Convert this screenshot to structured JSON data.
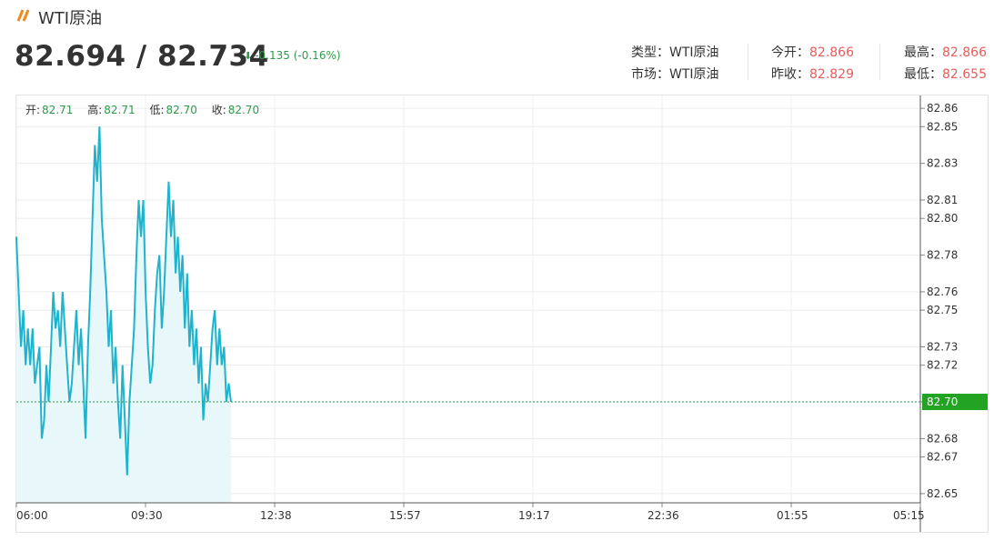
{
  "header": {
    "title": "WTI原油",
    "price": "82.694 / 82.734",
    "change": "-0.135 (-0.16%)"
  },
  "info": {
    "type_label": "类型：",
    "type_value": "WTI原油",
    "market_label": "市场：",
    "market_value": "WTI原油",
    "open_label": "今开：",
    "open_value": "82.866",
    "prev_close_label": "昨收：",
    "prev_close_value": "82.829",
    "high_label": "最高：",
    "high_value": "82.866",
    "low_label": "最低：",
    "low_value": "82.655"
  },
  "ohlc": {
    "open_label": "开:",
    "open_value": "82.71",
    "high_label": "高:",
    "high_value": "82.71",
    "low_label": "低:",
    "low_value": "82.70",
    "close_label": "收:",
    "close_value": "82.70"
  },
  "colors": {
    "line": "#1fb3cc",
    "area": "#e8f7f9",
    "current": "#2e9b4d",
    "grid": "#ececec",
    "up": "#e85b5b",
    "down": "#2e9b4d"
  },
  "chart_data": {
    "type": "area",
    "x_ticks": [
      "06:00",
      "09:30",
      "12:38",
      "15:57",
      "19:17",
      "22:36",
      "01:55",
      "05:15"
    ],
    "y_ticks": [
      82.86,
      82.85,
      82.83,
      82.81,
      82.8,
      82.78,
      82.76,
      82.75,
      82.73,
      82.72,
      82.7,
      82.68,
      82.67,
      82.65
    ],
    "ylim": [
      82.645,
      82.867
    ],
    "current_value": 82.7,
    "current_label": "82.70",
    "grid": true,
    "series": [
      {
        "values": [
          82.79,
          82.76,
          82.73,
          82.75,
          82.72,
          82.74,
          82.72,
          82.74,
          82.71,
          82.72,
          82.73,
          82.68,
          82.69,
          82.72,
          82.7,
          82.73,
          82.76,
          82.74,
          82.75,
          82.73,
          82.76,
          82.74,
          82.72,
          82.7,
          82.71,
          82.73,
          82.75,
          82.72,
          82.74,
          82.71,
          82.68,
          82.73,
          82.76,
          82.8,
          82.84,
          82.82,
          82.85,
          82.8,
          82.78,
          82.76,
          82.73,
          82.75,
          82.71,
          82.73,
          82.7,
          82.68,
          82.72,
          82.69,
          82.66,
          82.7,
          82.72,
          82.74,
          82.78,
          82.81,
          82.79,
          82.81,
          82.76,
          82.73,
          82.71,
          82.72,
          82.75,
          82.77,
          82.78,
          82.74,
          82.76,
          82.79,
          82.82,
          82.79,
          82.81,
          82.77,
          82.79,
          82.76,
          82.78,
          82.74,
          82.77,
          82.73,
          82.75,
          82.72,
          82.74,
          82.71,
          82.73,
          82.69,
          82.71,
          82.7,
          82.72,
          82.74,
          82.75,
          82.72,
          82.74,
          82.72,
          82.73,
          82.7,
          82.71,
          82.7
        ]
      }
    ]
  }
}
